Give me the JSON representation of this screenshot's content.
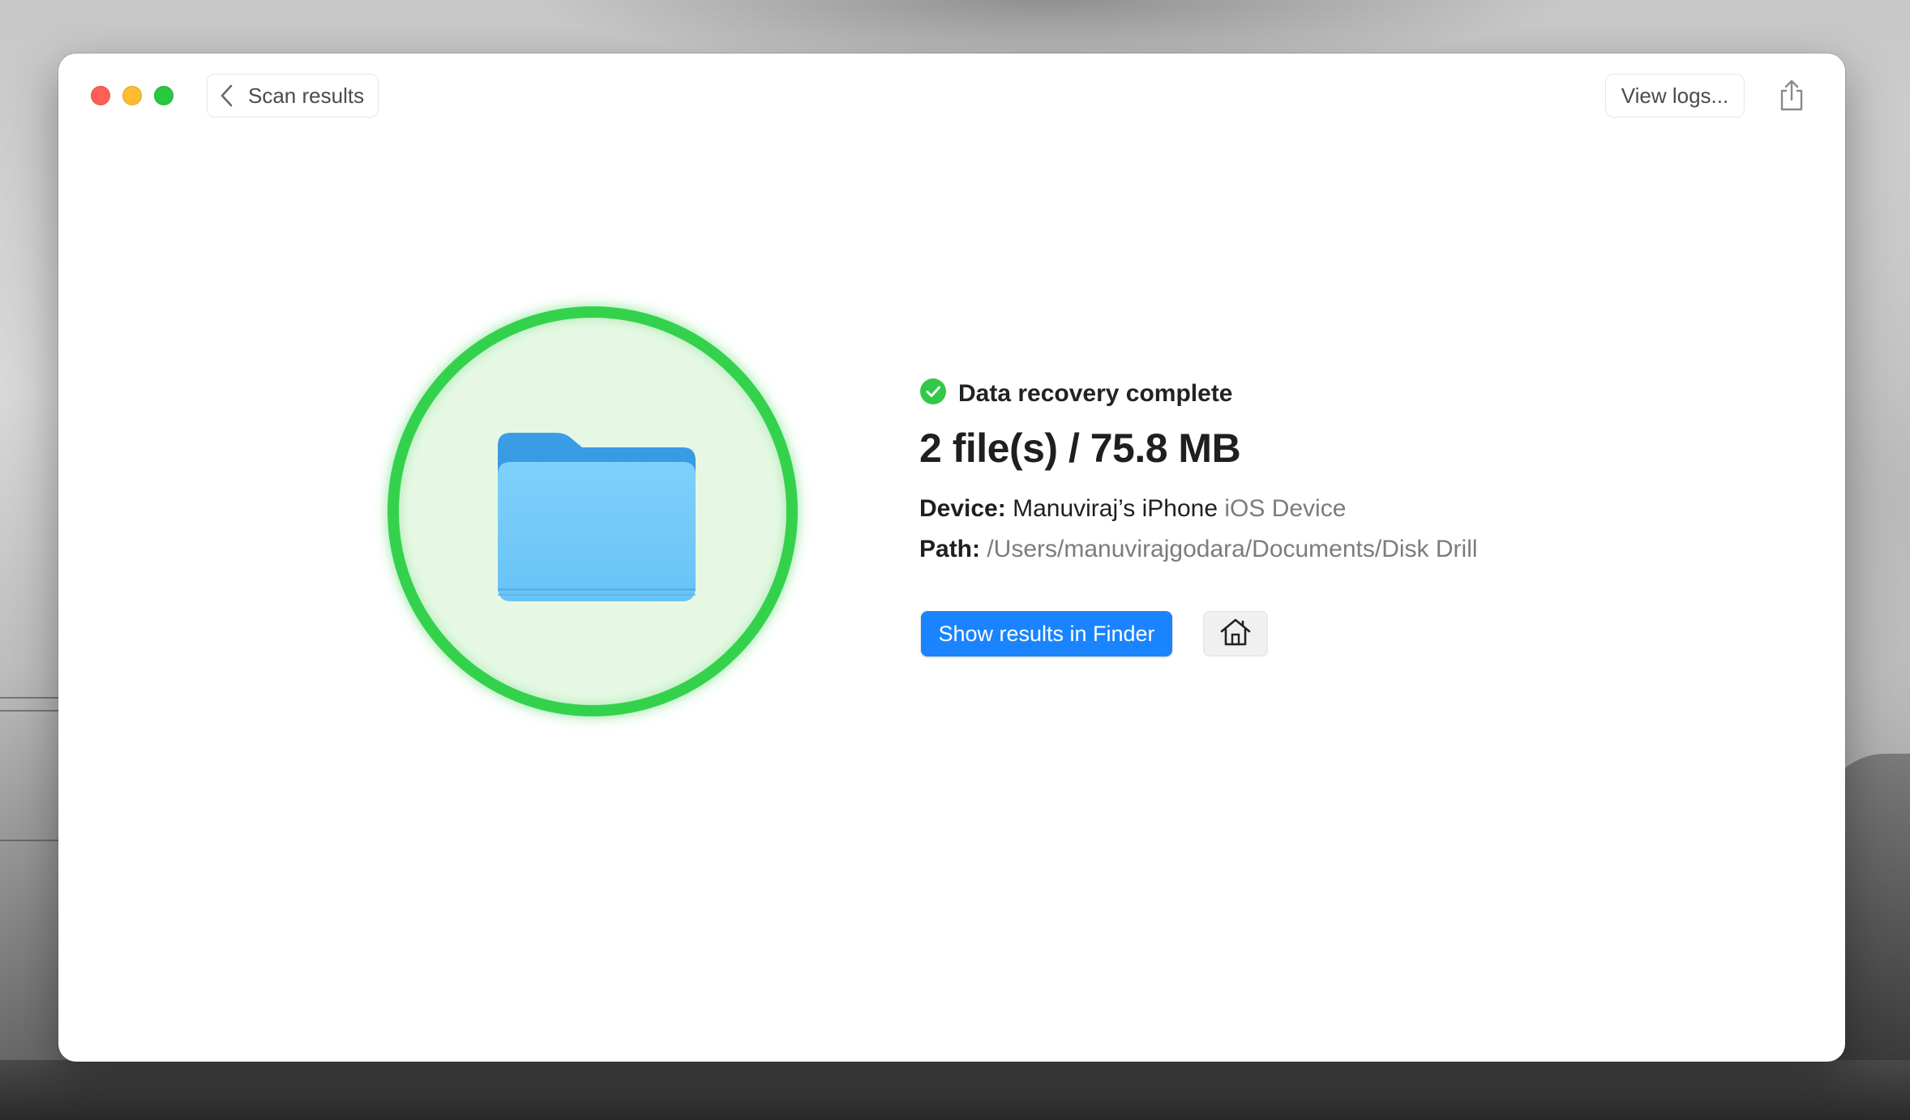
{
  "window": {
    "back_label": "Scan results",
    "view_logs_label": "View logs..."
  },
  "icons": {
    "back": "chevron-left-icon",
    "share": "share-icon",
    "folder": "folder-icon",
    "status": "checkmark-circle-icon",
    "home": "home-icon"
  },
  "result": {
    "status": "Data recovery complete",
    "summary": "2 file(s) / 75.8 MB",
    "device_label": "Device:",
    "device_name": "Manuviraj’s iPhone",
    "device_type": "iOS Device",
    "path_label": "Path:",
    "path_value": "/Users/manuvirajgodara/Documents/Disk Drill",
    "show_in_finder_label": "Show results in Finder"
  },
  "colors": {
    "accent": "#1a84ff",
    "success": "#34d24c",
    "folder": "#6cc6f7",
    "traffic_close": "#ff5f57",
    "traffic_minimize": "#febc2e",
    "traffic_zoom": "#28c840"
  }
}
